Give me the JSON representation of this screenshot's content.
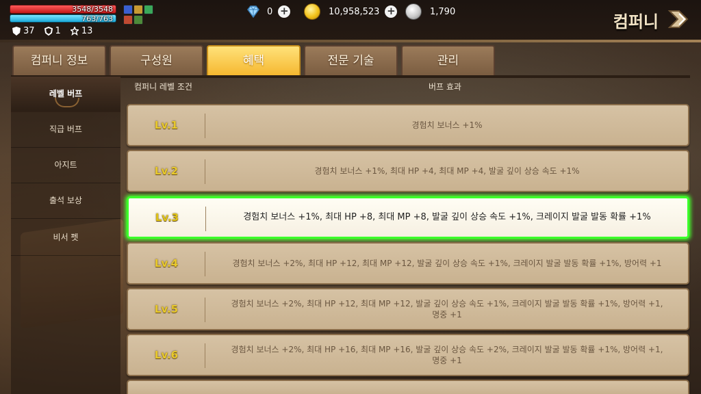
{
  "player": {
    "hp": "3548/3548",
    "mp": "763/763",
    "stats": [
      {
        "icon": "shield-badge-icon",
        "value": "37"
      },
      {
        "icon": "shield-outline-icon",
        "value": "1"
      },
      {
        "icon": "star-outline-icon",
        "value": "13"
      }
    ]
  },
  "currency": {
    "gems": "0",
    "gold": "10,958,523",
    "silver": "1,790"
  },
  "header": {
    "title": "컴퍼니"
  },
  "tabs": [
    {
      "label": "컴퍼니 정보",
      "active": false
    },
    {
      "label": "구성원",
      "active": false
    },
    {
      "label": "혜택",
      "active": true
    },
    {
      "label": "전문 기술",
      "active": false
    },
    {
      "label": "관리",
      "active": false
    }
  ],
  "side_menu": [
    {
      "label": "레벨 버프",
      "active": true
    },
    {
      "label": "직급 버프",
      "active": false
    },
    {
      "label": "아지트",
      "active": false
    },
    {
      "label": "출석 보상",
      "active": false
    },
    {
      "label": "비서 펫",
      "active": false
    }
  ],
  "table": {
    "level_header": "컴퍼니 레벨 조건",
    "effect_header": "버프 효과",
    "rows": [
      {
        "level": "Lv.1",
        "effect": "경험치 보너스 +1%"
      },
      {
        "level": "Lv.2",
        "effect": "경험치 보너스 +1%, 최대 HP +4, 최대 MP +4, 발굴 깊이 상승 속도 +1%"
      },
      {
        "level": "Lv.3",
        "effect": "경험치 보너스 +1%, 최대 HP +8, 최대 MP +8, 발굴 깊이 상승 속도 +1%, 크레이지 발굴 발동 확률 +1%"
      },
      {
        "level": "Lv.4",
        "effect": "경험치 보너스 +2%, 최대 HP +12, 최대 MP +12, 발굴 깊이 상승 속도 +1%, 크레이지 발굴 발동 확률 +1%, 방어력 +1"
      },
      {
        "level": "Lv.5",
        "effect": "경험치 보너스 +2%, 최대 HP +12, 최대 MP +12, 발굴 깊이 상승 속도 +1%, 크레이지 발굴 발동 확률 +1%, 방어력 +1, 명중 +1"
      },
      {
        "level": "Lv.6",
        "effect": "경험치 보너스 +2%, 최대 HP +16, 최대 MP +16, 발굴 깊이 상승 속도 +2%, 크레이지 발굴 발동 확률 +1%, 방어력 +1, 명중 +1"
      }
    ],
    "current_level_index": 2
  },
  "colors": {
    "tab_active": "#f5b72e",
    "highlight_border": "#3cff2a",
    "level_text": "#e8c92c"
  }
}
